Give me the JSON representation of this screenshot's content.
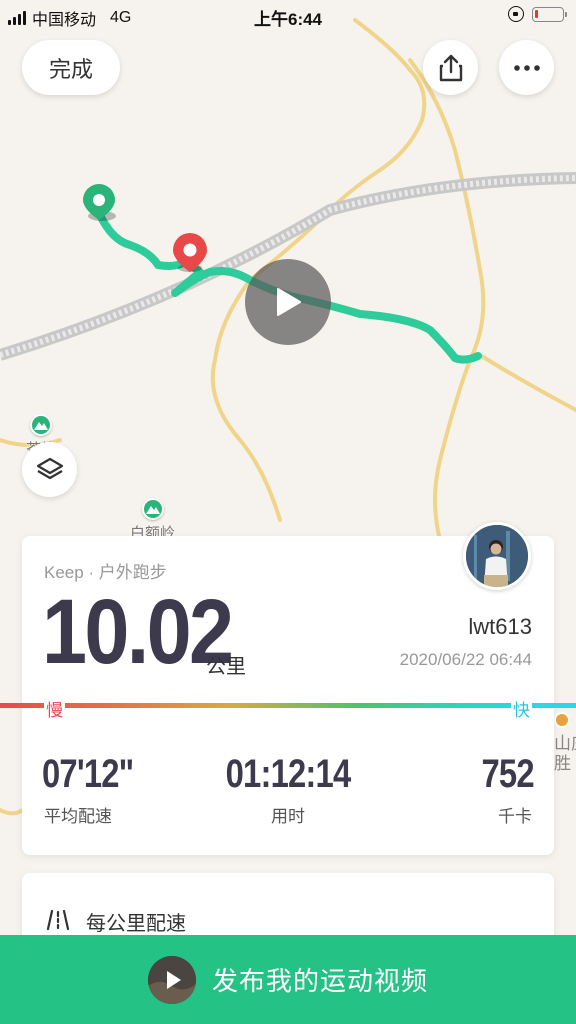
{
  "status_bar": {
    "carrier": "中国移动",
    "network": "4G",
    "time": "上午6:44"
  },
  "header": {
    "done_label": "完成",
    "share_icon": "share-icon",
    "more_icon": "more-icon"
  },
  "map": {
    "poi_labels": [
      "白额岭"
    ],
    "poi_partial_label": "茶笼",
    "side_label_top": "山庄",
    "side_label_bottom": "胜"
  },
  "summary": {
    "activity_type": "Keep · 户外跑步",
    "distance": "10.02",
    "distance_unit": "公里",
    "username": "lwt613",
    "datetime": "2020/06/22 06:44",
    "pace_slow_label": "慢",
    "pace_fast_label": "快",
    "metrics": [
      {
        "value": "07'12\"",
        "label": "平均配速"
      },
      {
        "value": "01:12:14",
        "label": "用时"
      },
      {
        "value": "752",
        "label": "千卡"
      }
    ]
  },
  "per_km": {
    "title": "每公里配速"
  },
  "publish": {
    "label": "发布我的运动视频"
  },
  "colors": {
    "accent": "#25c286",
    "track": "#2ecc9a",
    "start_marker": "#2ab47a",
    "end_marker": "#e84848"
  }
}
